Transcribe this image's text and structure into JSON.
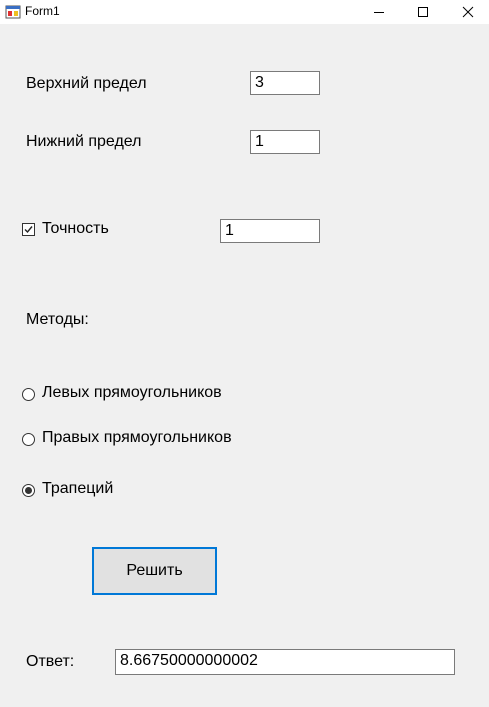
{
  "window": {
    "title": "Form1",
    "app_icon": "winforms-app-icon",
    "controls": [
      "minimize-icon",
      "maximize-icon",
      "close-icon"
    ]
  },
  "upper_limit": {
    "label": "Верхний предел",
    "value": "3"
  },
  "lower_limit": {
    "label": "Нижний предел",
    "value": "1"
  },
  "precision": {
    "label": "Точность",
    "checked": true,
    "value": "1"
  },
  "methods": {
    "heading": "Методы:",
    "options": [
      {
        "label": "Левых прямоугольников",
        "selected": false
      },
      {
        "label": "Правых прямоугольников",
        "selected": false
      },
      {
        "label": "Трапеций",
        "selected": true
      }
    ]
  },
  "solve_button": {
    "label": "Решить"
  },
  "answer": {
    "label": "Ответ:",
    "value": "8.66750000000002"
  },
  "colors": {
    "focus_border": "#0078d7",
    "background": "#f0f0f0"
  }
}
